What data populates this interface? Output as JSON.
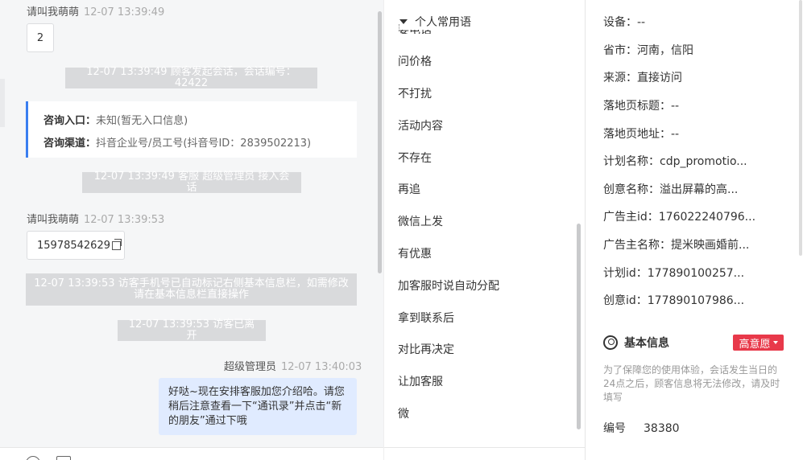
{
  "chat": {
    "msg1": {
      "sender": "请叫我萌萌",
      "time": "12-07 13:39:49",
      "content": "2"
    },
    "sys1": "12-07 13:39:49 顾客发起会话，会话编号：42422",
    "entry": {
      "entry_label": "咨询入口：",
      "entry_value": "未知(暂无入口信息)",
      "channel_label": "咨询渠道：",
      "channel_value": "抖音企业号/员工号(抖音号ID：2839502213)"
    },
    "sys2": "12-07 13:39:49 客服 超级管理员 接入会话",
    "msg2": {
      "sender": "请叫我萌萌",
      "time": "12-07 13:39:53",
      "content": "15978542629"
    },
    "sys3": "12-07 13:39:53 访客手机号已自动标记右侧基本信息栏，如需修改请在基本信息栏直接操作",
    "sys4": "12-07 13:39:53 访客已离开",
    "msg3": {
      "sender": "超级管理员",
      "time": "12-07 13:40:03",
      "content": "好哒~现在安排客服加您介绍哈。请您稍后注意查看一下“通讯录”并点击“新的朋友”通过下哦"
    }
  },
  "phrases": {
    "header": "个人常用语",
    "cut_item": "要电话",
    "items": [
      "问价格",
      "不打扰",
      "活动内容",
      "不存在",
      "再追",
      "微信上发",
      "有优惠",
      "加客服时说自动分配",
      "拿到联系后",
      "对比再决定",
      "让加客服",
      "微"
    ]
  },
  "info": {
    "rows": [
      "设备：--",
      "省市：河南，信阳",
      "来源：直接访问",
      "落地页标题：--",
      "落地页地址：--",
      "计划名称：cdp_promotio...",
      "创意名称：溢出屏幕的高...",
      "广告主id：176022240796...",
      "广告主名称：提米映画婚前...",
      "计划id：177890100257...",
      "创意id：177890107986..."
    ],
    "basic_title": "基本信息",
    "intent": "高意愿",
    "notice": "为了保障您的使用体验，会话发生当日的24点之后，顾客信息将无法修改，请及时填写",
    "id_label": "编号",
    "id_value": "38380"
  },
  "colors": {
    "accent": "#3a7ef0",
    "badge": "#e8394a",
    "bubble_blue": "#e0ebff",
    "system_gray": "#d9dadc"
  }
}
